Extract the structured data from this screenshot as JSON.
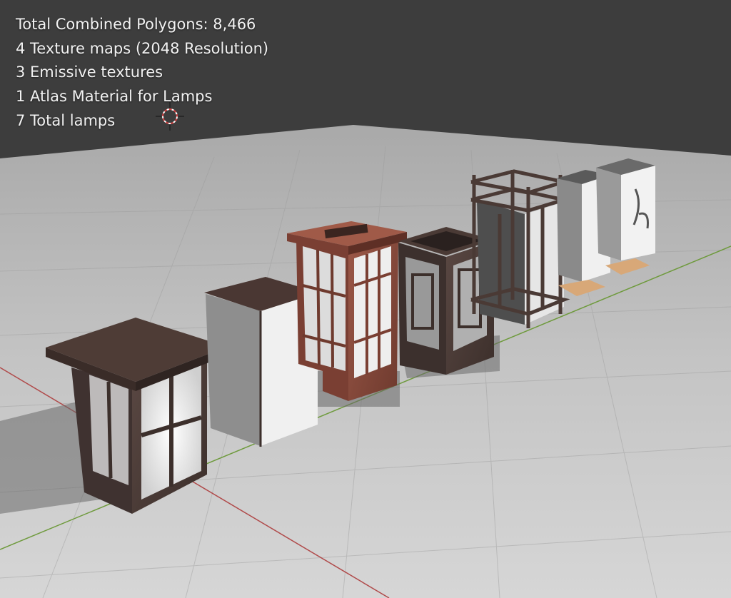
{
  "info_lines": [
    "Total Combined Polygons: 8,466",
    "4 Texture maps (2048 Resolution)",
    "3 Emissive textures",
    "1 Atlas Material for Lamps",
    "7 Total lamps"
  ],
  "colors": {
    "background": "#3d3d3d",
    "floor": "#cfcfcf",
    "x_axis": "#b04a4a",
    "y_axis": "#6e9a3c",
    "dark_wood": "#4a3a35",
    "red_wood": "#8a4a3a",
    "paper": "#eeeeee",
    "base_wood": "#d8a878"
  },
  "scene": {
    "object_count": 7,
    "icons": [
      "3d-cursor-icon"
    ]
  }
}
